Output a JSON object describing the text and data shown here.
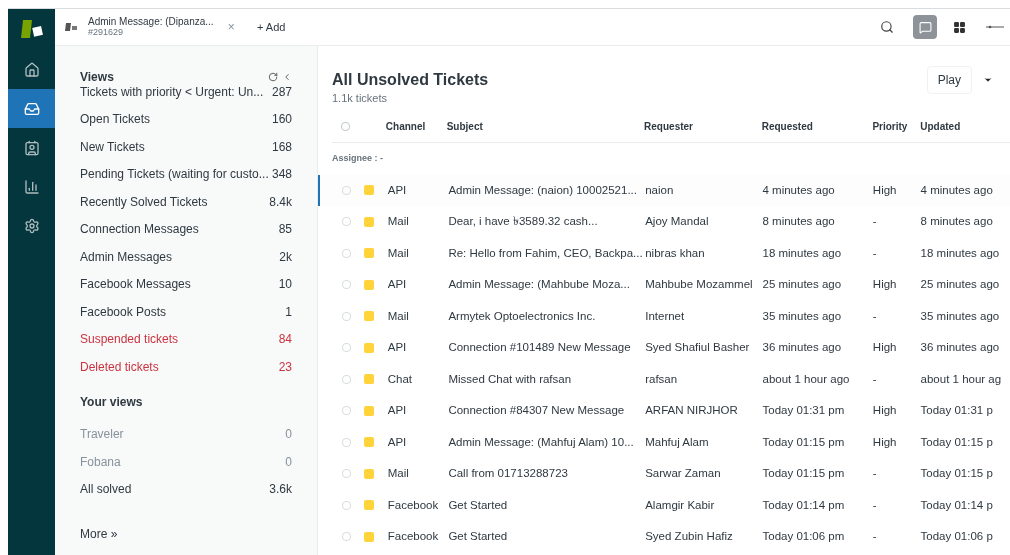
{
  "tab_bar": {
    "tabs": [
      {
        "title": "Admin Message: (Dipanza...",
        "subtitle": "#291629",
        "close": "×"
      }
    ],
    "add_button": "+ Add"
  },
  "nav_rail": {
    "items": [
      {
        "kind": "home",
        "selected": false
      },
      {
        "kind": "views",
        "selected": true
      },
      {
        "kind": "customers",
        "selected": false
      },
      {
        "kind": "reports",
        "selected": false
      },
      {
        "kind": "settings",
        "selected": false
      }
    ]
  },
  "views_panel": {
    "heading": "Views",
    "views": [
      {
        "label": "Tickets with priority < Urgent: Un...",
        "count": "287",
        "kind": "normal"
      },
      {
        "label": "Open Tickets",
        "count": "160",
        "kind": "normal"
      },
      {
        "label": "New Tickets",
        "count": "168",
        "kind": "normal"
      },
      {
        "label": "Pending Tickets (waiting for custo...",
        "count": "348",
        "kind": "normal"
      },
      {
        "label": "Recently Solved Tickets",
        "count": "8.4k",
        "kind": "normal"
      },
      {
        "label": "Connection Messages",
        "count": "85",
        "kind": "normal"
      },
      {
        "label": "Admin Messages",
        "count": "2k",
        "kind": "normal"
      },
      {
        "label": "Facebook Messages",
        "count": "10",
        "kind": "normal"
      },
      {
        "label": "Facebook Posts",
        "count": "1",
        "kind": "normal"
      },
      {
        "label": "Suspended tickets",
        "count": "84",
        "kind": "danger"
      },
      {
        "label": "Deleted tickets",
        "count": "23",
        "kind": "danger"
      }
    ],
    "your_views_heading": "Your views",
    "your_views": [
      {
        "label": "Traveler",
        "count": "0",
        "kind": "inactive"
      },
      {
        "label": "Fobana",
        "count": "0",
        "kind": "inactive"
      },
      {
        "label": "All solved",
        "count": "3.6k",
        "kind": "normal"
      }
    ],
    "more_link": "More »"
  },
  "main": {
    "title": "All Unsolved Tickets",
    "subtitle": "1.1k tickets",
    "play_button": "Play",
    "table": {
      "select_all_checked": false,
      "columns": [
        "Channel",
        "Subject",
        "Requester",
        "Requested",
        "Priority",
        "Updated"
      ],
      "group_label": "Assignee : -",
      "rows": [
        {
          "selected": true,
          "checked": false,
          "channel": "API",
          "subject": "Admin Message: (naion) 10002521...",
          "requester": "naion",
          "requested": "4 minutes ago",
          "priority": "High",
          "updated": "4 minutes ago"
        },
        {
          "selected": false,
          "checked": false,
          "channel": "Mail",
          "subject": "Dear, i have ৳3589.32 cash...",
          "requester": "Ajoy Mandal",
          "requested": "8 minutes ago",
          "priority": "-",
          "updated": "8 minutes ago"
        },
        {
          "selected": false,
          "checked": false,
          "channel": "Mail",
          "subject": "Re: Hello from Fahim, CEO, Backpa...",
          "requester": "nibras khan",
          "requested": "18 minutes ago",
          "priority": "-",
          "updated": "18 minutes ago"
        },
        {
          "selected": false,
          "checked": false,
          "channel": "API",
          "subject": "Admin Message: (Mahbube Moza...",
          "requester": "Mahbube Mozammel",
          "requested": "25 minutes ago",
          "priority": "High",
          "updated": "25 minutes ago"
        },
        {
          "selected": false,
          "checked": false,
          "channel": "Mail",
          "subject": "Armytek Optoelectronics Inc.",
          "requester": "Internet",
          "requested": "35 minutes ago",
          "priority": "-",
          "updated": "35 minutes ago"
        },
        {
          "selected": false,
          "checked": false,
          "channel": "API",
          "subject": "Connection #101489 New Message",
          "requester": "Syed Shafiul Basher",
          "requested": "36 minutes ago",
          "priority": "High",
          "updated": "36 minutes ago"
        },
        {
          "selected": false,
          "checked": false,
          "channel": "Chat",
          "subject": "Missed Chat with rafsan",
          "requester": "rafsan",
          "requested": "about 1 hour ago",
          "priority": "-",
          "updated": "about 1 hour ag"
        },
        {
          "selected": false,
          "checked": false,
          "channel": "API",
          "subject": "Connection #84307 New Message",
          "requester": "ARFAN NIRJHOR",
          "requested": "Today 01:31 pm",
          "priority": "High",
          "updated": "Today 01:31 p"
        },
        {
          "selected": false,
          "checked": false,
          "channel": "API",
          "subject": "Admin Message: (Mahfuj Alam) 10...",
          "requester": "Mahfuj Alam",
          "requested": "Today 01:15 pm",
          "priority": "High",
          "updated": "Today 01:15 p"
        },
        {
          "selected": false,
          "checked": false,
          "channel": "Mail",
          "subject": "Call from 01713288723",
          "requester": "Sarwar Zaman",
          "requested": "Today 01:15 pm",
          "priority": "-",
          "updated": "Today 01:15 p"
        },
        {
          "selected": false,
          "checked": false,
          "channel": "Facebook",
          "subject": "Get Started",
          "requester": "Alamgir Kabir",
          "requested": "Today 01:14 pm",
          "priority": "-",
          "updated": "Today 01:14 p"
        },
        {
          "selected": false,
          "checked": false,
          "channel": "Facebook",
          "subject": "Get Started",
          "requester": "Syed Zubin Hafiz",
          "requested": "Today 01:06 pm",
          "priority": "-",
          "updated": "Today 01:06 p"
        }
      ]
    }
  }
}
